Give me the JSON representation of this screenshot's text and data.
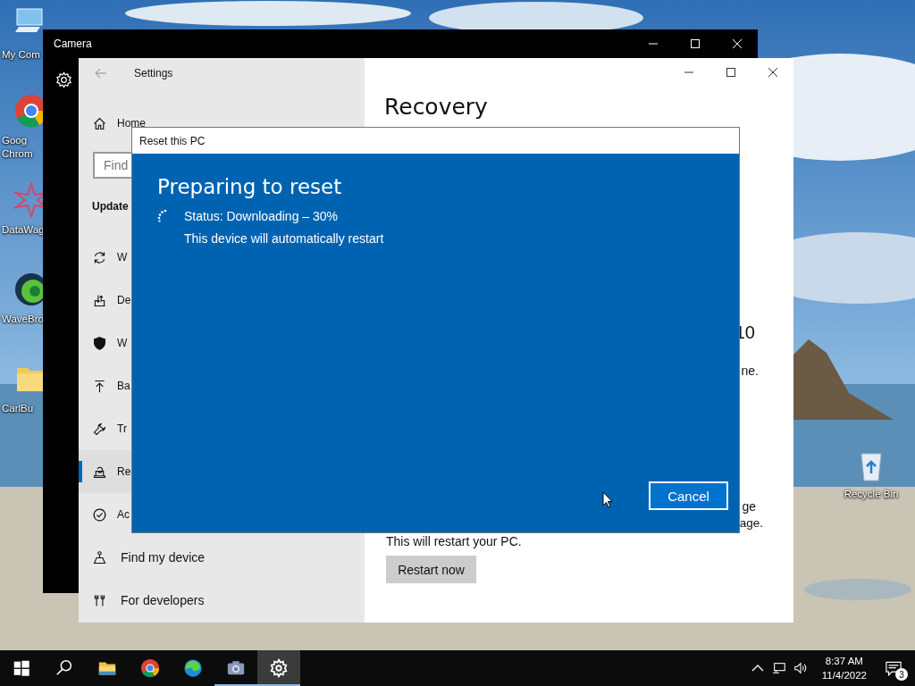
{
  "desktop": {
    "icons": [
      {
        "kind": "computer",
        "label": "My Com"
      },
      {
        "kind": "chrome",
        "label": "Goog Chrom"
      },
      {
        "kind": "star",
        "label": "DataWag"
      },
      {
        "kind": "wave",
        "label": "WaveBro"
      },
      {
        "kind": "folder",
        "label": "CarlBu"
      },
      {
        "kind": "recycle",
        "label": "Recycle Bin"
      }
    ]
  },
  "camera_window": {
    "title": "Camera"
  },
  "settings_window": {
    "title": "Settings",
    "nav": [
      {
        "kind": "link",
        "label": "Home",
        "selected": false
      },
      {
        "kind": "search",
        "placeholder": "Find"
      },
      {
        "kind": "heading",
        "label": "Update"
      },
      {
        "kind": "item",
        "label": "W",
        "selected": false
      },
      {
        "kind": "item",
        "label": "De",
        "selected": false
      },
      {
        "kind": "item",
        "label": "W",
        "selected": false
      },
      {
        "kind": "item",
        "label": "Ba",
        "selected": false
      },
      {
        "kind": "item",
        "label": "Tr",
        "selected": false
      },
      {
        "kind": "item",
        "label": "Re",
        "selected": true
      },
      {
        "kind": "item",
        "label": "Ac",
        "selected": false
      },
      {
        "kind": "item",
        "label": "Find my device",
        "selected": false
      },
      {
        "kind": "item",
        "label": "For developers",
        "selected": false
      }
    ],
    "content": {
      "heading": "Recovery",
      "fragments": [
        "10",
        "ne.",
        "ge",
        "age."
      ],
      "restart_note": "This will restart your PC.",
      "restart_button": "Restart now"
    }
  },
  "dialog": {
    "title": "Reset this PC",
    "heading": "Preparing to reset",
    "status": "Status: Downloading – 30%",
    "note": "This device will automatically restart",
    "cancel_button": "Cancel"
  },
  "taskbar": {
    "items": [
      {
        "kind": "start",
        "selected": false,
        "running": false
      },
      {
        "kind": "search",
        "selected": false,
        "running": false
      },
      {
        "kind": "explorer",
        "selected": false,
        "running": false
      },
      {
        "kind": "chrome",
        "selected": false,
        "running": false
      },
      {
        "kind": "edge",
        "selected": false,
        "running": false
      },
      {
        "kind": "camera",
        "selected": false,
        "running": true
      },
      {
        "kind": "settings",
        "selected": true,
        "running": true
      }
    ],
    "tray": {
      "time": "8:37 AM",
      "date": "11/4/2022",
      "notification_count": "3"
    }
  }
}
